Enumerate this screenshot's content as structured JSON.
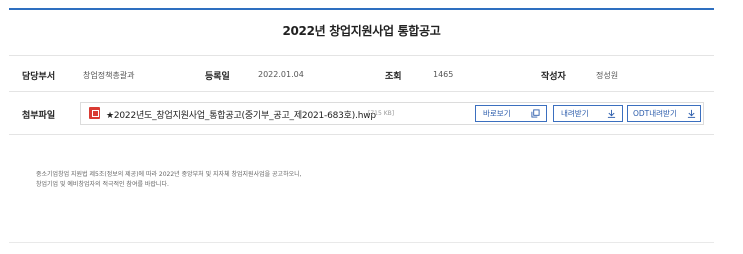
{
  "title": "2022년 창업지원사업 통합공고",
  "meta": {
    "dept_label": "담당부서",
    "dept_value": "창업정책총괄과",
    "date_label": "등록일",
    "date_value": "2022.01.04",
    "views_label": "조회",
    "views_value": "1465",
    "author_label": "작성자",
    "author_value": "정성원"
  },
  "attachment": {
    "label": "첨부파일",
    "file_name": "★2022년도_창업지원사업_통합공고(중기부_공고_제2021-683호).hwp",
    "file_size": "[715 KB]",
    "file_icon": "hwp-file-icon",
    "preview_label": "바로보기",
    "download_label": "내려받기",
    "odt_label": "ODT내려받기"
  },
  "body": {
    "line1": "중소기업창업 지원법 제5조(정보의 제공)에 따라 2022년 중앙부처 및 지자체 창업지원사업을 공고하오니,",
    "line2": "창업기업 및 예비창업자의 적극적인 참여를 바랍니다."
  },
  "colors": {
    "accent": "#2e6fc0",
    "button_border": "#3b6fbf",
    "hwp_icon": "#d93b33"
  }
}
